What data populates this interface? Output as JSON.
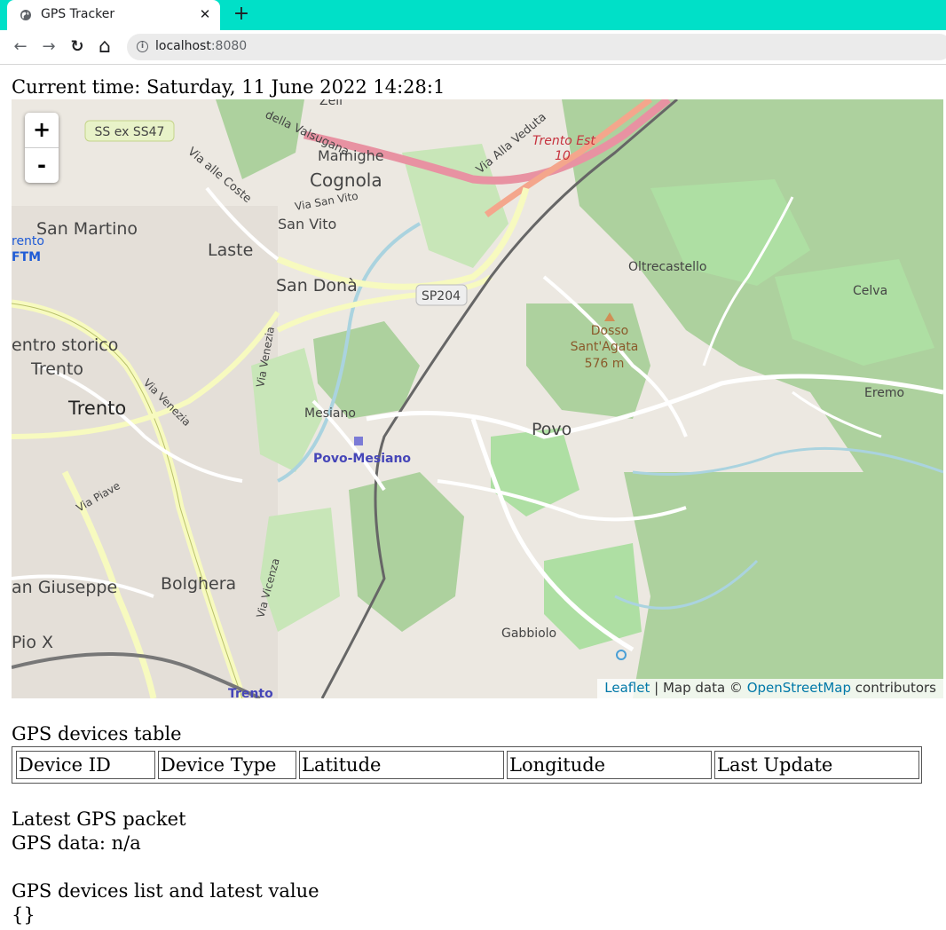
{
  "browser": {
    "tab_title": "GPS Tracker",
    "tab_close": "✕",
    "new_tab": "+",
    "url_host": "localhost",
    "url_port": ":8080",
    "back": "←",
    "forward": "→",
    "reload": "↻",
    "home": "⌂"
  },
  "page": {
    "current_time_label": "Current time: Saturday, 11 June 2022 14:28:1",
    "map": {
      "zoom_in": "+",
      "zoom_out": "-",
      "attribution_leaflet": "Leaflet",
      "attribution_sep": " | Map data © ",
      "attribution_osm": "OpenStreetMap",
      "attribution_tail": " contributors",
      "labels": {
        "ss47": "SS ex SS47",
        "valsugana": "della Valsugana",
        "zell": "Zell",
        "marnighe": "Marnighe",
        "cognola": "Cognola",
        "via_alle_coste": "Via alle Coste",
        "via_alla_veduta": "Via Alla Veduta",
        "trento_est": "Trento Est",
        "ten": "10",
        "via_san_vito": "Via San Vito",
        "san_vito": "San Vito",
        "san_martino": "San Martino",
        "rento": "rento",
        "ftm": "FTM",
        "laste": "Laste",
        "san_dona": "San Donà",
        "sp204": "SP204",
        "oltrecastello": "Oltrecastello",
        "celva": "Celva",
        "centro_storico": "entro storico",
        "trento_small": "Trento",
        "via_venezia": "Via Venezia",
        "via_veneza2": "Via Venezia",
        "dosso": "Dosso",
        "sant_agata": "Sant'Agata",
        "elev": "576 m",
        "eremo": "Eremo",
        "trento": "Trento",
        "mesiano": "Mesiano",
        "povo": "Povo",
        "povo_mesiano": "Povo-Mesiano",
        "via_piave": "Via Piave",
        "san_giuseppe": "an Giuseppe",
        "bolghera": "Bolghera",
        "via_vicenza": "Via Vicenza",
        "pio_x": "Pio X",
        "gabbiolo": "Gabbiolo",
        "trento_station": "Trento"
      }
    },
    "devices_table_title": "GPS devices table",
    "devices_table_headers": [
      "Device ID",
      "Device Type",
      "Latitude",
      "Longitude",
      "Last Update"
    ],
    "latest_packet_title": "Latest GPS packet",
    "gps_data": "GPS data: n/a",
    "devices_list_title": "GPS devices list and latest value",
    "devices_list_value": "{}"
  }
}
